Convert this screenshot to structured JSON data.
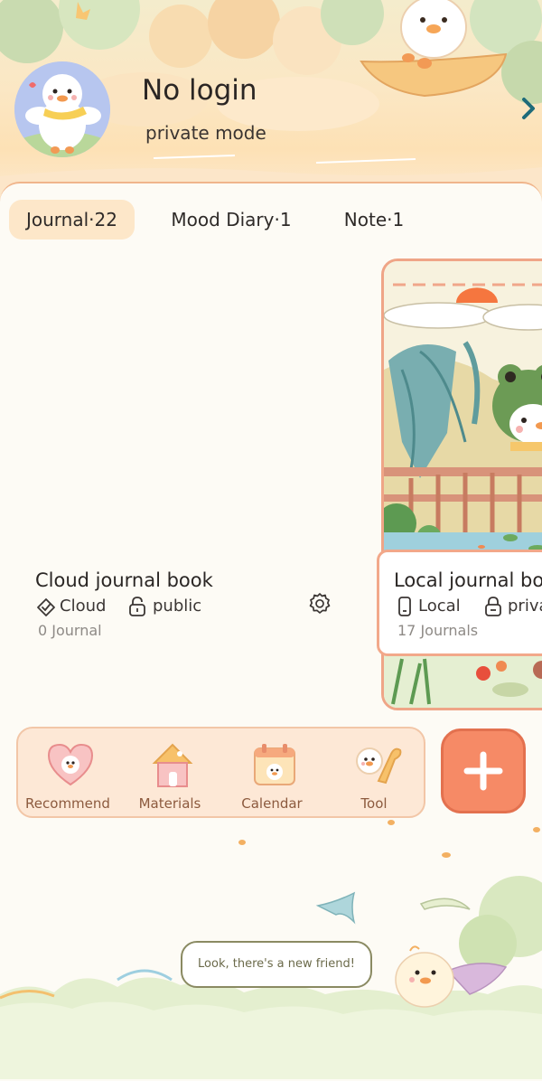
{
  "header": {
    "username": "No login",
    "mode": "private mode",
    "arrow_icon": "chevron-right-icon"
  },
  "tabs": [
    {
      "label": "Journal·22",
      "active": true
    },
    {
      "label": "Mood Diary·1",
      "active": false
    },
    {
      "label": "Note·1",
      "active": false
    }
  ],
  "books": {
    "cloud": {
      "title": "Cloud journal book",
      "storage_label": "Cloud",
      "visibility_label": "public",
      "count_label": "0 Journal"
    },
    "local": {
      "title": "Local journal bo",
      "storage_label": "Local",
      "visibility_label": "priva",
      "count_label": "17 Journals"
    }
  },
  "toolbar": {
    "items": [
      {
        "label": "Recommend",
        "icon": "heart-duck-icon"
      },
      {
        "label": "Materials",
        "icon": "house-icon"
      },
      {
        "label": "Calendar",
        "icon": "calendar-icon"
      },
      {
        "label": "Tool",
        "icon": "tool-icon"
      }
    ],
    "add_icon": "plus-icon"
  },
  "scene": {
    "bubble_text": "Look, there's a new friend!"
  },
  "colors": {
    "accent": "#f68a66",
    "tab_active_bg": "#fde7c9",
    "toolbar_bg": "#fde8d6",
    "card_border": "#efa587",
    "arrow": "#1f6b7a"
  }
}
